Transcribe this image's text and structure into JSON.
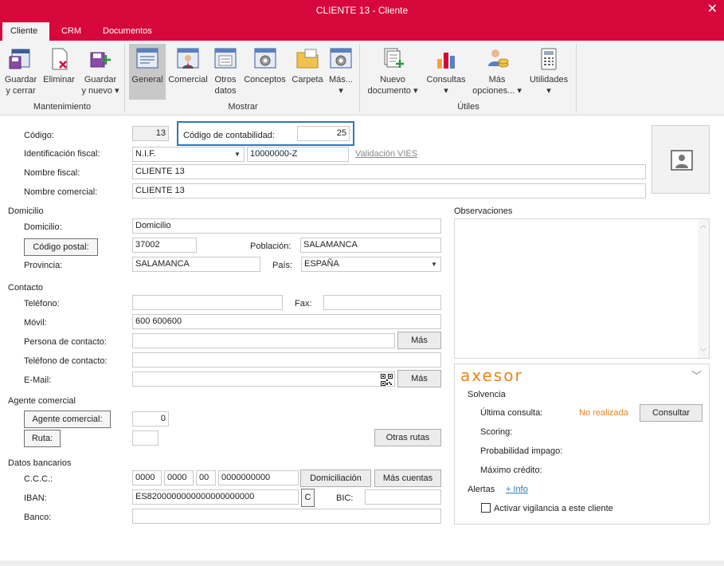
{
  "window": {
    "title": "CLIENTE 13 - Cliente"
  },
  "tabs": [
    {
      "label": "Cliente"
    },
    {
      "label": "CRM"
    },
    {
      "label": "Documentos"
    }
  ],
  "ribbon": {
    "guardar_cerrar": [
      "Guardar",
      "y cerrar"
    ],
    "eliminar": "Eliminar",
    "guardar_nuevo": [
      "Guardar",
      "y nuevo ▾"
    ],
    "general": "General",
    "comercial": "Comercial",
    "otros_datos": [
      "Otros",
      "datos"
    ],
    "conceptos": "Conceptos",
    "carpeta": "Carpeta",
    "mas": [
      "Más...",
      "▾"
    ],
    "nuevo_documento": [
      "Nuevo",
      "documento ▾"
    ],
    "consultas": [
      "Consultas",
      "▾"
    ],
    "mas_opciones": [
      "Más",
      "opciones... ▾"
    ],
    "utilidades": [
      "Utilidades",
      "▾"
    ],
    "groups": {
      "mantenimiento": "Mantenimiento",
      "mostrar": "Mostrar",
      "utiles": "Útiles"
    }
  },
  "form": {
    "codigo_label": "Código:",
    "codigo_value": "13",
    "codigo_contabilidad_label": "Código de contabilidad:",
    "codigo_contabilidad_value": "25",
    "identificacion_label": "Identificación fiscal:",
    "identificacion_tipo": "N.I.F.",
    "identificacion_value": "10000000-Z",
    "validacion_vies": "Validación VIES",
    "nombre_fiscal_label": "Nombre fiscal:",
    "nombre_fiscal_value": "CLIENTE 13",
    "nombre_comercial_label": "Nombre comercial:",
    "nombre_comercial_value": "CLIENTE 13"
  },
  "domicilio": {
    "section": "Domicilio",
    "domicilio_label": "Domicilio:",
    "domicilio_value": "Domicilio",
    "codigo_postal_btn": "Código postal:",
    "codigo_postal_value": "37002",
    "poblacion_label": "Población:",
    "poblacion_value": "SALAMANCA",
    "provincia_label": "Provincia:",
    "provincia_value": "SALAMANCA",
    "pais_label": "País:",
    "pais_value": "ESPAÑA"
  },
  "contacto": {
    "section": "Contacto",
    "telefono_label": "Teléfono:",
    "telefono_value": "",
    "fax_label": "Fax:",
    "fax_value": "",
    "movil_label": "Móvil:",
    "movil_value": "600 600600",
    "persona_label": "Persona de contacto:",
    "persona_value": "",
    "mas_btn": "Más",
    "telefono_contacto_label": "Teléfono de contacto:",
    "telefono_contacto_value": "",
    "email_label": "E-Mail:",
    "email_value": ""
  },
  "agente": {
    "section": "Agente comercial",
    "agente_btn": "Agente comercial:",
    "agente_value": "0",
    "ruta_btn": "Ruta:",
    "ruta_value": "",
    "otras_rutas_btn": "Otras rutas"
  },
  "bancarios": {
    "section": "Datos bancarios",
    "ccc_label": "C.C.C.:",
    "ccc1": "0000",
    "ccc2": "0000",
    "ccc3": "00",
    "ccc4": "0000000000",
    "domiciliacion_btn": "Domiciliación",
    "mas_cuentas_btn": "Más cuentas",
    "iban_label": "IBAN:",
    "iban_value": "ES8200000000000000000000",
    "c_btn": "C",
    "bic_label": "BIC:",
    "bic_value": "",
    "banco_label": "Banco:",
    "banco_value": ""
  },
  "observaciones": {
    "label": "Observaciones",
    "value": ""
  },
  "axesor": {
    "logo": "axesor",
    "solvencia": "Solvencia",
    "ultima_consulta_label": "Última consulta:",
    "ultima_consulta_value": "No realizada",
    "consultar_btn": "Consultar",
    "scoring_label": "Scoring:",
    "probabilidad_label": "Probabilidad impago:",
    "maximo_credito_label": "Máximo crédito:",
    "alertas_label": "Alertas",
    "info_link": "+ Info",
    "vigilancia_label": "Activar vigilancia a este cliente"
  },
  "colors": {
    "brand": "#d6083b",
    "axesor_orange": "#e8841a",
    "focus_border": "#2a7ab8"
  }
}
